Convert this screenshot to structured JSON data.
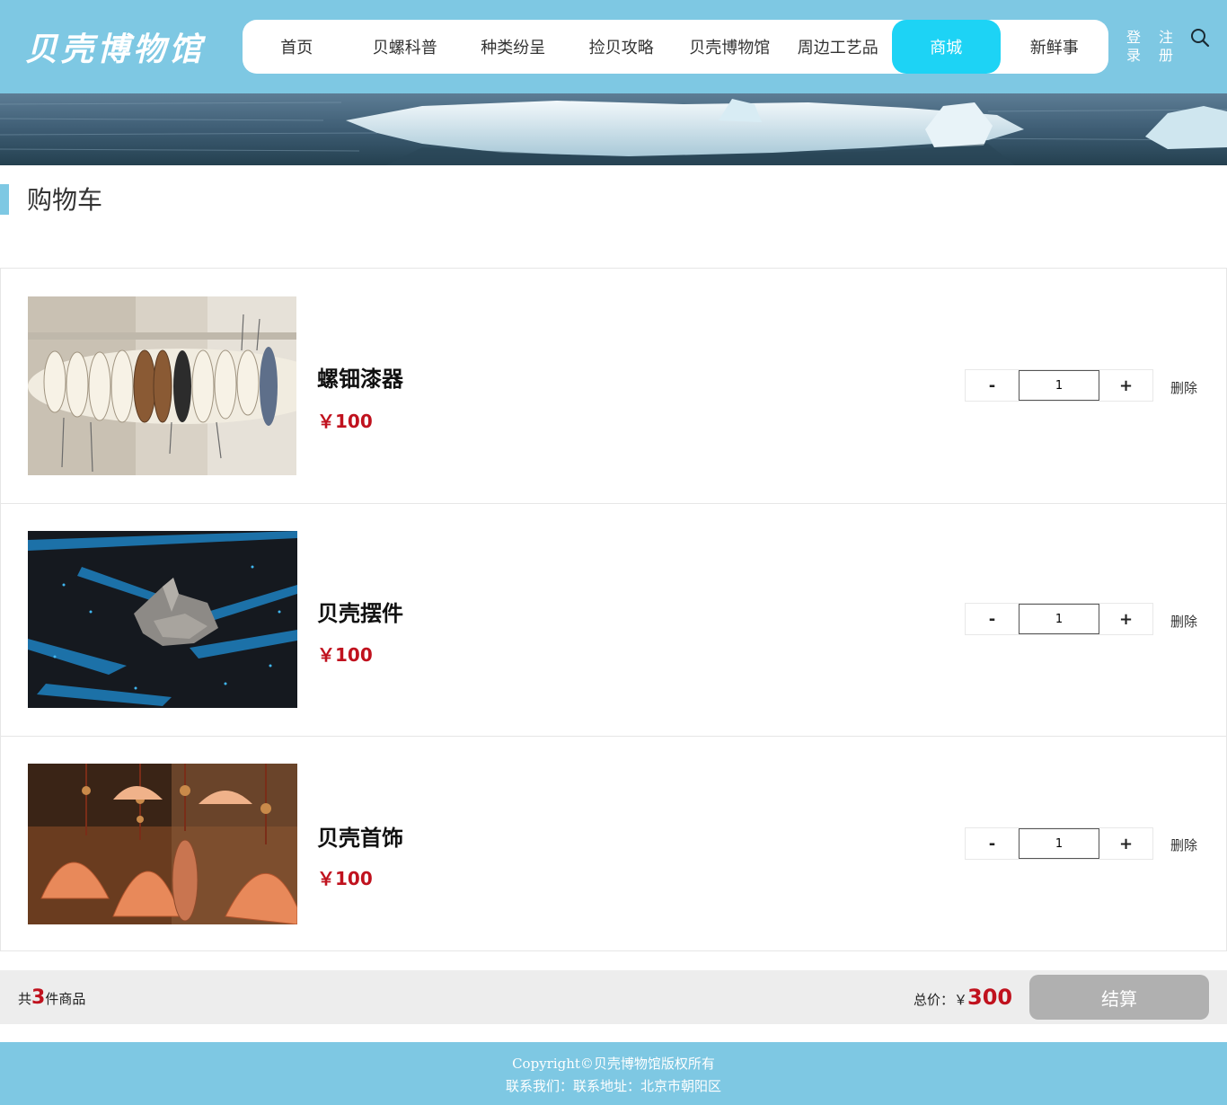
{
  "brand": {
    "logo_text": "贝壳博物馆"
  },
  "nav": {
    "items": [
      {
        "label": "首页",
        "active": false
      },
      {
        "label": "贝螺科普",
        "active": false
      },
      {
        "label": "种类纷呈",
        "active": false
      },
      {
        "label": "捡贝攻略",
        "active": false
      },
      {
        "label": "贝壳博物馆",
        "active": false
      },
      {
        "label": "周边工艺品",
        "active": false
      },
      {
        "label": "商城",
        "active": true
      },
      {
        "label": "新鲜事",
        "active": false
      }
    ],
    "login_label": "登录",
    "register_label": "注册",
    "search_icon": "search-icon"
  },
  "page": {
    "title": "购物车"
  },
  "cart": {
    "items": [
      {
        "name": "螺钿漆器",
        "price": "￥100",
        "quantity": "1",
        "minus_label": "-",
        "plus_label": "+",
        "delete_label": "删除",
        "image": "shell-bracelets-photo"
      },
      {
        "name": "贝壳摆件",
        "price": "￥100",
        "quantity": "1",
        "minus_label": "-",
        "plus_label": "+",
        "delete_label": "删除",
        "image": "conch-ornament-photo"
      },
      {
        "name": "贝壳首饰",
        "price": "￥100",
        "quantity": "1",
        "minus_label": "-",
        "plus_label": "+",
        "delete_label": "删除",
        "image": "shell-pendants-photo"
      }
    ]
  },
  "summary": {
    "count_prefix": "共",
    "count": "3",
    "count_suffix": "件商品",
    "total_label": "总价：￥",
    "total": "300",
    "checkout_label": "结算"
  },
  "footer": {
    "copyright": "Copyright©贝壳博物馆版权所有",
    "contact": "联系我们：联系地址：北京市朝阳区"
  },
  "colors": {
    "header_bg": "#7ec8e3",
    "nav_active": "#1dd3f5",
    "price": "#c0121e",
    "checkout_bg": "#b0b0b0"
  }
}
